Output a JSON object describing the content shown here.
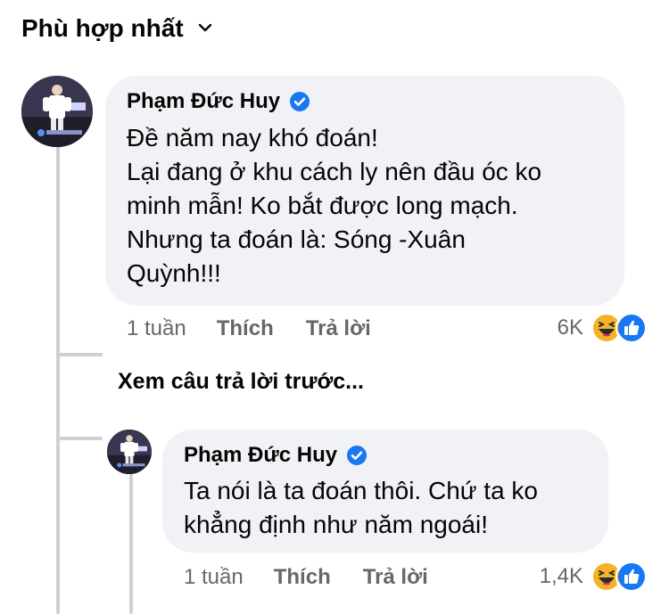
{
  "sort": {
    "label": "Phù hợp nhất",
    "icon": "chevron-down-icon"
  },
  "comments": [
    {
      "author": "Phạm Đức Huy",
      "verified": true,
      "text": "Đề năm nay khó đoán!\nLại đang ở khu cách ly nên đầu óc ko\nminh mẫn! Ko bắt được long mạch.\nNhưng ta đoán là: Sóng -Xuân\nQuỳnh!!!",
      "time": "1 tuần",
      "like_label": "Thích",
      "reply_label": "Trả lời",
      "reaction_count": "6K",
      "reactions": [
        "haha-icon",
        "like-icon"
      ]
    },
    {
      "author": "Phạm Đức Huy",
      "verified": true,
      "text": "Ta nói là ta đoán thôi. Chứ ta ko\nkhẳng định như năm ngoái!",
      "time": "1 tuần",
      "like_label": "Thích",
      "reply_label": "Trả lời",
      "reaction_count": "1,4K",
      "reactions": [
        "haha-icon",
        "like-icon"
      ]
    }
  ],
  "see_previous_replies": "Xem câu trả lời trước...",
  "colors": {
    "bubble": "#f0f2f5",
    "meta": "#65676b",
    "verified": "#1877f2",
    "like": "#1877f2",
    "haha": "#f7b125"
  }
}
